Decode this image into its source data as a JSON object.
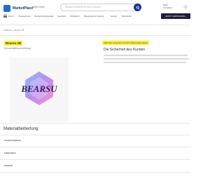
{
  "header": {
    "logo_text": "MarketPlace",
    "logo_sub": "Mein Konto",
    "search_placeholder": "Wonach möchtest du heute suchen?",
    "account_line1": "Hallo",
    "account_line2": "Anmelden",
    "account_icon": "user-icon"
  },
  "nav": {
    "items": [
      "Menü",
      "Topangebote",
      "Sonderanfertigungen",
      "Haushalt",
      "Möbelwelt",
      "Baugerätevermietung",
      "Garten",
      "Marktplatz"
    ],
    "sell_button": "JETZT VERKAUFEN ›"
  },
  "breadcrumb": "Startseite › Bearsu 2B",
  "product": {
    "title": "Bearsu 2B",
    "subtitle": "Überschriftenbeschreibung",
    "image_text": "BEARSU"
  },
  "info": {
    "highlight": "Jetzt den Gutschein für den Online-Kauf nutzen",
    "heading": "Die Sicherheit des Kunden"
  },
  "details": {
    "title": "Materialbeiberlung",
    "rows": [
      "Ansprechpartner",
      "Lieferzeiten",
      "Gewicht"
    ]
  }
}
